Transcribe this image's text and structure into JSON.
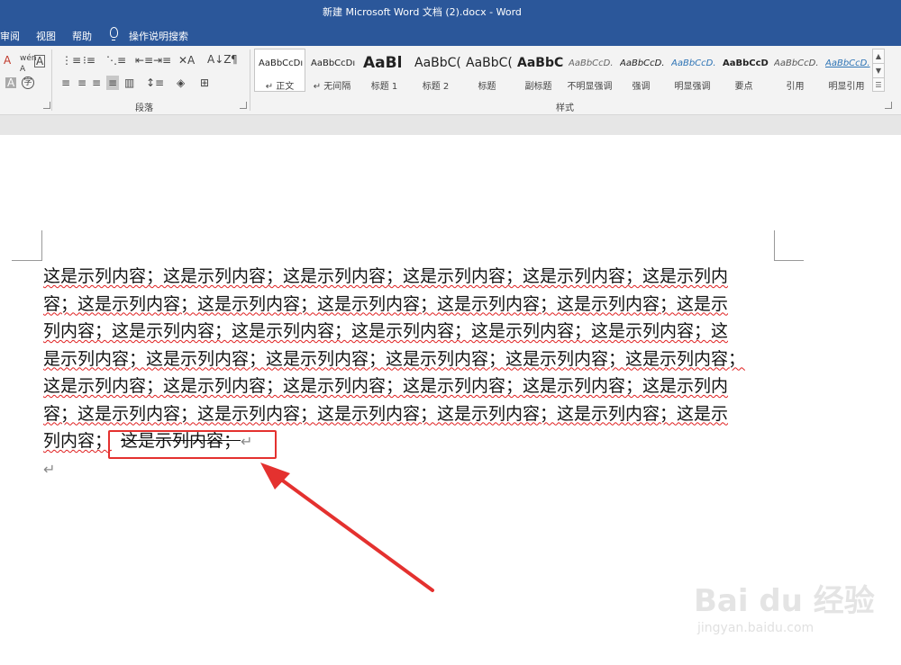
{
  "window": {
    "title": "新建 Microsoft Word 文档 (2).docx  -  Word"
  },
  "menu": {
    "review": "审阅",
    "view": "视图",
    "help": "帮助",
    "tell_me": "操作说明搜索"
  },
  "ribbon": {
    "paragraph_label": "段落",
    "styles_label": "样式",
    "styles": [
      {
        "sample": "AaBbCcDı",
        "name": "↵ 正文"
      },
      {
        "sample": "AaBbCcDı",
        "name": "↵ 无间隔"
      },
      {
        "sample": "AaBl",
        "name": "标题 1"
      },
      {
        "sample": "AaBbC(",
        "name": "标题 2"
      },
      {
        "sample": "AaBbC(",
        "name": "标题"
      },
      {
        "sample": "AaBbC(",
        "name": "副标题"
      },
      {
        "sample": "AaBbCcD.",
        "name": "不明显强调"
      },
      {
        "sample": "AaBbCcD.",
        "name": "强调"
      },
      {
        "sample": "AaBbCcD.",
        "name": "明显强调"
      },
      {
        "sample": "AaBbCcD",
        "name": "要点"
      },
      {
        "sample": "AaBbCcD.",
        "name": "引用"
      },
      {
        "sample": "AaBbCcD.",
        "name": "明显引用"
      }
    ]
  },
  "document": {
    "lines": [
      "这是示列内容；这是示列内容；这是示列内容；这是示列内容；这是示列内容；这是示列内",
      "容；这是示列内容；这是示列内容；这是示列内容；这是示列内容；这是示列内容；这是示",
      "列内容；这是示列内容；这是示列内容；这是示列内容；这是示列内容；这是示列内容；这",
      "是示列内容；这是示列内容；这是示列内容；这是示列内容；这是示列内容；这是示列内容；",
      "这是示列内容；这是示列内容；这是示列内容；这是示列内容；这是示列内容；这是示列内",
      "容；这是示列内容；这是示列内容；这是示列内容；这是示列内容；这是示列内容；这是示"
    ],
    "last_line_prefix": "列内容；",
    "last_line_struck": "这是示列内容；",
    "pilcrow": "↵"
  },
  "watermark": {
    "brand": "Bai du 经验",
    "url": "jingyan.baidu.com"
  },
  "colors": {
    "accent": "#2b579a",
    "annotation": "#e4312f",
    "squiggle": "#e02020"
  }
}
